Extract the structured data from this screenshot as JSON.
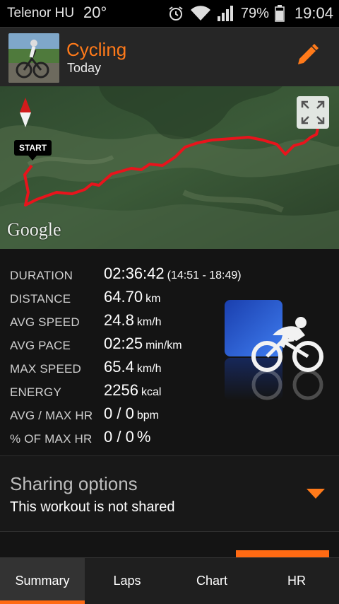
{
  "status_bar": {
    "carrier": "Telenor HU",
    "temperature": "20°",
    "battery": "79%",
    "time": "19:04",
    "icons": [
      "alarm-icon",
      "wifi-icon",
      "signal-icon",
      "battery-icon"
    ]
  },
  "header": {
    "title": "Cycling",
    "subtitle": "Today",
    "edit_icon": "pencil-icon"
  },
  "map": {
    "attribution": "Google",
    "start_label": "START",
    "route_color": "#e8141c"
  },
  "stats": [
    {
      "label": "DURATION",
      "value": "02:36:42",
      "unit": "",
      "extra": "(14:51 - 18:49)"
    },
    {
      "label": "DISTANCE",
      "value": "64.70",
      "unit": "km",
      "extra": ""
    },
    {
      "label": "AVG SPEED",
      "value": "24.8",
      "unit": "km/h",
      "extra": ""
    },
    {
      "label": "AVG PACE",
      "value": "02:25",
      "unit": "min/km",
      "extra": ""
    },
    {
      "label": "MAX SPEED",
      "value": "65.4",
      "unit": "km/h",
      "extra": ""
    },
    {
      "label": "ENERGY",
      "value": "2256",
      "unit": "kcal",
      "extra": ""
    },
    {
      "label": "AVG / MAX HR",
      "value": "0 / 0",
      "unit": "bpm",
      "extra": ""
    },
    {
      "label": "% OF MAX HR",
      "value": "0 / 0",
      "unit": "%",
      "extra": ""
    }
  ],
  "sharing": {
    "heading": "Sharing options",
    "status": "This workout is not shared"
  },
  "tabs": [
    {
      "label": "Summary",
      "active": true
    },
    {
      "label": "Laps",
      "active": false
    },
    {
      "label": "Chart",
      "active": false
    },
    {
      "label": "HR",
      "active": false
    }
  ],
  "colors": {
    "accent": "#ff7a1a",
    "route": "#e8141c"
  }
}
